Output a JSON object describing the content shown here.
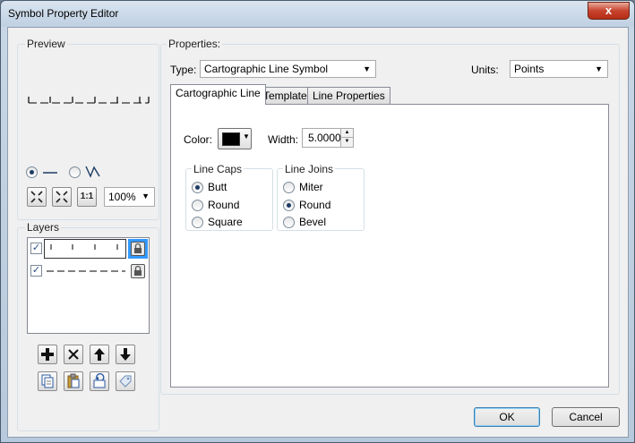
{
  "window": {
    "title": "Symbol Property Editor",
    "close_glyph": "x"
  },
  "preview": {
    "label": "Preview",
    "zoom_value": "100%",
    "zoom_tools": [
      "zoom-in-icon",
      "zoom-out-icon",
      "actual-size-icon"
    ],
    "actual_size_text": "1:1"
  },
  "layers": {
    "label": "Layers"
  },
  "properties": {
    "label": "Properties:",
    "type_label": "Type:",
    "type_value": "Cartographic Line Symbol",
    "units_label": "Units:",
    "units_value": "Points"
  },
  "tabs": [
    "Cartographic Line",
    "Template",
    "Line Properties"
  ],
  "line": {
    "color_label": "Color:",
    "color_value": "#000000",
    "width_label": "Width:",
    "width_value": "5.0000"
  },
  "line_caps": {
    "label": "Line Caps",
    "options": [
      "Butt",
      "Round",
      "Square"
    ],
    "selected": "Butt"
  },
  "line_joins": {
    "label": "Line Joins",
    "options": [
      "Miter",
      "Round",
      "Bevel"
    ],
    "selected": "Round"
  },
  "buttons": {
    "ok": "OK",
    "cancel": "Cancel"
  },
  "colors": {
    "accent": "#3399ff",
    "title_bg": "#c9d7e6",
    "client_bg": "#f0f0f0"
  }
}
